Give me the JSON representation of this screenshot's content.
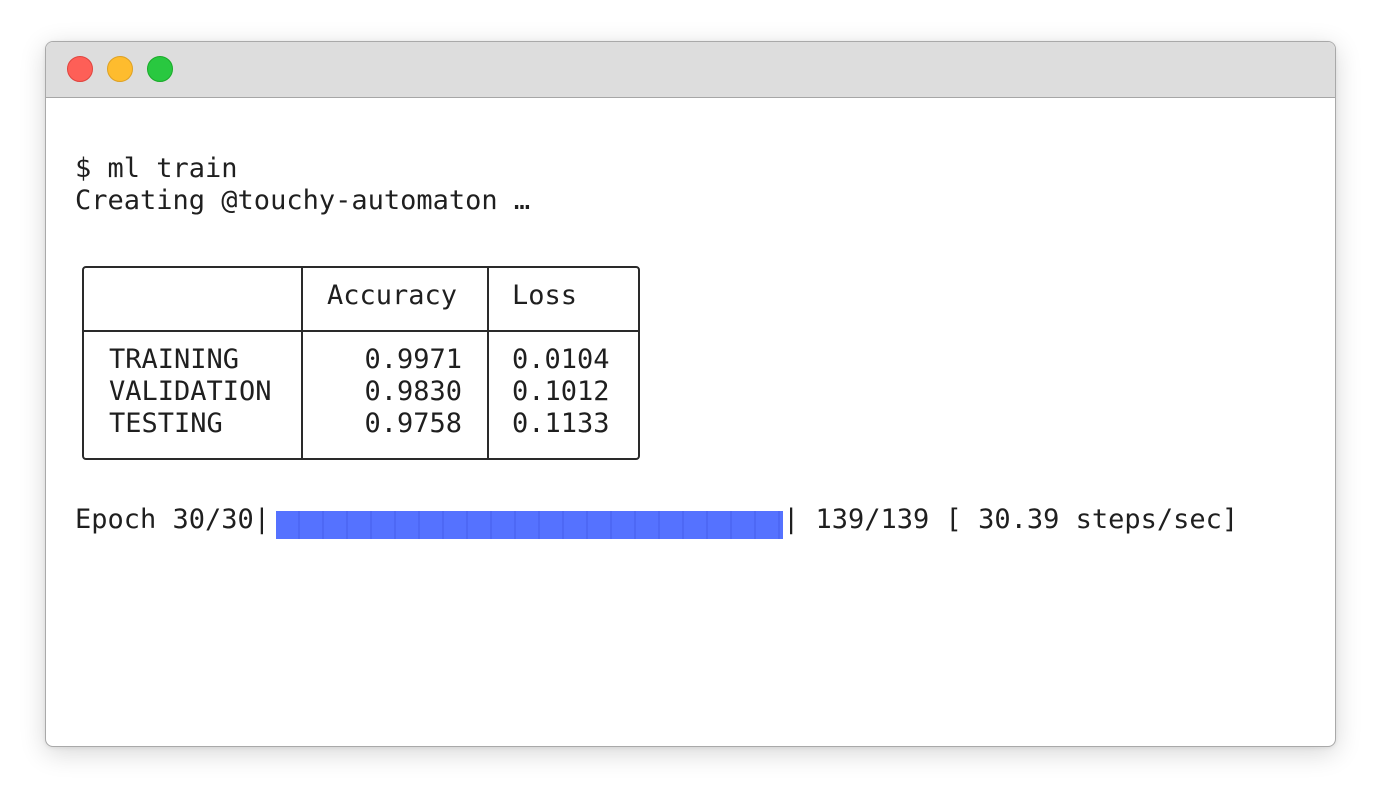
{
  "window": {
    "traffic_lights": [
      "close",
      "minimize",
      "zoom"
    ]
  },
  "terminal": {
    "prompt_line": "$ ml train",
    "status_line": "Creating @touchy-automaton …",
    "table": {
      "headers": [
        "",
        "Accuracy",
        "Loss"
      ],
      "rows": [
        {
          "label": "TRAINING",
          "accuracy": "0.9971",
          "loss": "0.0104"
        },
        {
          "label": "VALIDATION",
          "accuracy": "0.9830",
          "loss": "0.1012"
        },
        {
          "label": "TESTING",
          "accuracy": "0.9758",
          "loss": "0.1133"
        }
      ]
    },
    "progress": {
      "prefix": "Epoch 30/30|",
      "suffix": "| 139/139 [ 30.39 steps/sec]",
      "fraction": 1.0,
      "color": "#5572ff"
    }
  }
}
